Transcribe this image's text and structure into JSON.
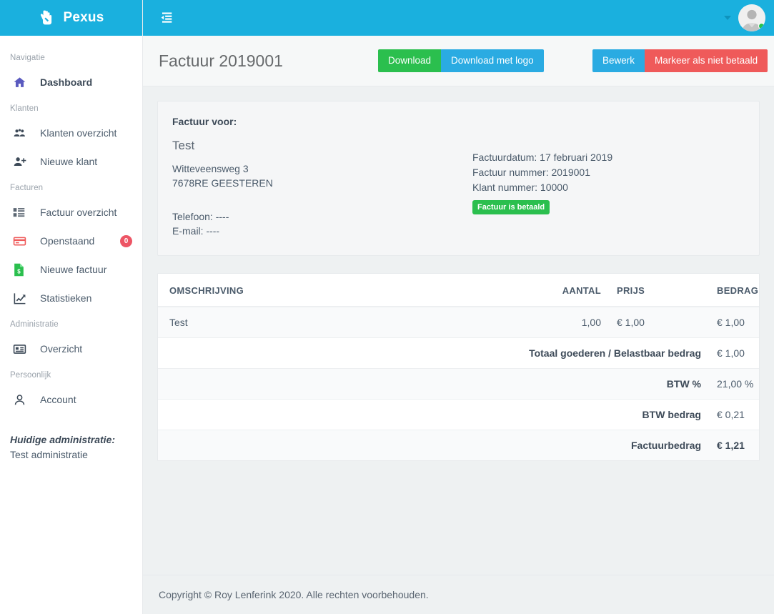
{
  "brand": {
    "name": "Pexus",
    "logo_icon": "hand-logo-icon"
  },
  "colors": {
    "primary": "#1ab0de",
    "green": "#2bbf4e",
    "blue": "#2aabe2",
    "red": "#ef5a5a",
    "badge_red": "#ed5565",
    "sidebar_bg": "#ffffff",
    "content_bg": "#eef1f2"
  },
  "sidebar": {
    "sections": [
      {
        "title": "Navigatie",
        "items": [
          {
            "label": "Dashboard",
            "icon": "home-icon",
            "active": true,
            "badge": null
          }
        ]
      },
      {
        "title": "Klanten",
        "items": [
          {
            "label": "Klanten overzicht",
            "icon": "users-icon",
            "active": false,
            "badge": null
          },
          {
            "label": "Nieuwe klant",
            "icon": "user-plus-icon",
            "active": false,
            "badge": null
          }
        ]
      },
      {
        "title": "Facturen",
        "items": [
          {
            "label": "Factuur overzicht",
            "icon": "list-grid-icon",
            "active": false,
            "badge": null
          },
          {
            "label": "Openstaand",
            "icon": "credit-card-icon",
            "active": false,
            "badge": "0"
          },
          {
            "label": "Nieuwe factuur",
            "icon": "invoice-document-icon",
            "active": false,
            "badge": null
          },
          {
            "label": "Statistieken",
            "icon": "chart-line-icon",
            "active": false,
            "badge": null
          }
        ]
      },
      {
        "title": "Administratie",
        "items": [
          {
            "label": "Overzicht",
            "icon": "address-card-icon",
            "active": false,
            "badge": null
          }
        ]
      },
      {
        "title": "Persoonlijk",
        "items": [
          {
            "label": "Account",
            "icon": "user-icon",
            "active": false,
            "badge": null
          }
        ]
      }
    ],
    "current_admin_label": "Huidige administratie:",
    "current_admin_value": "Test administratie"
  },
  "topbar": {
    "toggle_icon": "sidebar-collapse-icon",
    "caret_icon": "chevron-down-icon",
    "avatar_icon": "user-avatar",
    "status": "online"
  },
  "pagehead": {
    "title": "Factuur 2019001",
    "buttons": {
      "download": "Download",
      "download_logo": "Download met logo",
      "edit": "Bewerk",
      "mark_unpaid": "Markeer als niet betaald"
    }
  },
  "invoice": {
    "for_label": "Factuur voor:",
    "customer_name": "Test",
    "address_line1": "Witteveensweg 3",
    "address_line2": "7678RE GEESTEREN",
    "phone": "Telefoon: ----",
    "email": "E-mail: ----",
    "date": "Factuurdatum: 17 februari 2019",
    "number": "Factuur nummer: 2019001",
    "customer_number": "Klant nummer: 10000",
    "status_badge": "Factuur is betaald"
  },
  "table": {
    "headers": {
      "description": "OMSCHRIJVING",
      "quantity": "AANTAL",
      "price": "PRIJS",
      "amount": "BEDRAG"
    },
    "rows": [
      {
        "description": "Test",
        "quantity": "1,00",
        "price": "€ 1,00",
        "amount": "€ 1,00"
      }
    ],
    "summary": [
      {
        "label": "Totaal goederen / Belastbaar bedrag",
        "value": "€ 1,00",
        "bold_value": false
      },
      {
        "label": "BTW %",
        "value": "21,00 %",
        "bold_value": false
      },
      {
        "label": "BTW bedrag",
        "value": "€ 0,21",
        "bold_value": false
      },
      {
        "label": "Factuurbedrag",
        "value": "€ 1,21",
        "bold_value": true
      }
    ]
  },
  "footer": {
    "text": "Copyright © Roy Lenferink 2020. Alle rechten voorbehouden."
  }
}
